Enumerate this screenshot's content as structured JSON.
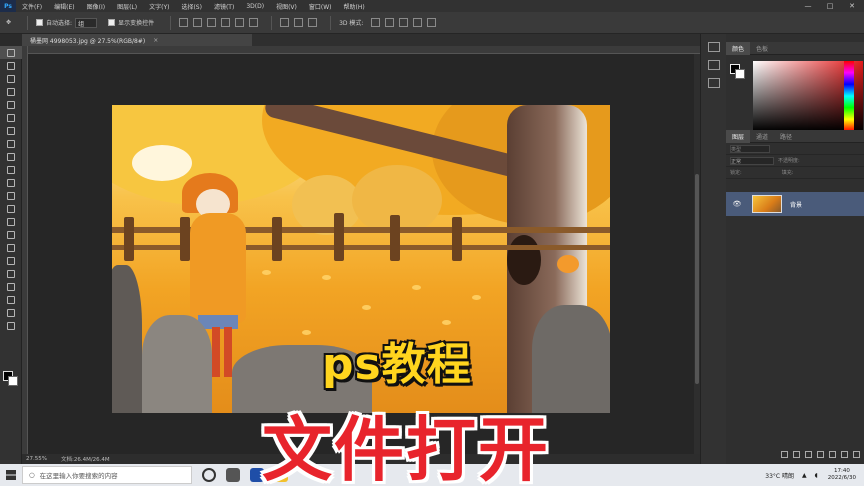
{
  "app": {
    "logo": "Ps"
  },
  "menu": [
    "文件(F)",
    "编辑(E)",
    "图像(I)",
    "图层(L)",
    "文字(Y)",
    "选择(S)",
    "滤镜(T)",
    "3D(D)",
    "视图(V)",
    "窗口(W)",
    "帮助(H)"
  ],
  "window_controls": {
    "minimize": "—",
    "maximize": "□",
    "close": "✕"
  },
  "options": {
    "auto_select_label": "自动选择:",
    "auto_select_value": "组",
    "show_transform_label": "显示变换控件",
    "mode_3d_label": "3D 模式:"
  },
  "document_tab": {
    "title": "桶墨网 4998053.jpg @ 27.5%(RGB/8#)",
    "close": "×"
  },
  "artwork": {
    "icon": "autumn-illustration"
  },
  "overlay": {
    "subtitle": "ps教程",
    "title": "文件打开"
  },
  "status": {
    "zoom": "27.55%",
    "doc_size": "文档:26.4M/26.4M"
  },
  "color_panel": {
    "tabs": [
      "颜色",
      "色板"
    ]
  },
  "layers_panel": {
    "tabs": [
      "图层",
      "通道",
      "路径"
    ],
    "filter_placeholder": "类型",
    "blend_mode": "正常",
    "opacity_label": "不透明度:",
    "lock_label": "锁定:",
    "fill_label": "填充:",
    "layer_name": "背景",
    "eye": "👁"
  },
  "taskbar": {
    "search_icon": "○",
    "search_placeholder": "在这里输入你要搜索的内容",
    "weather": "33°C 晴朗",
    "time": "17:40",
    "date": "2022/6/30"
  }
}
